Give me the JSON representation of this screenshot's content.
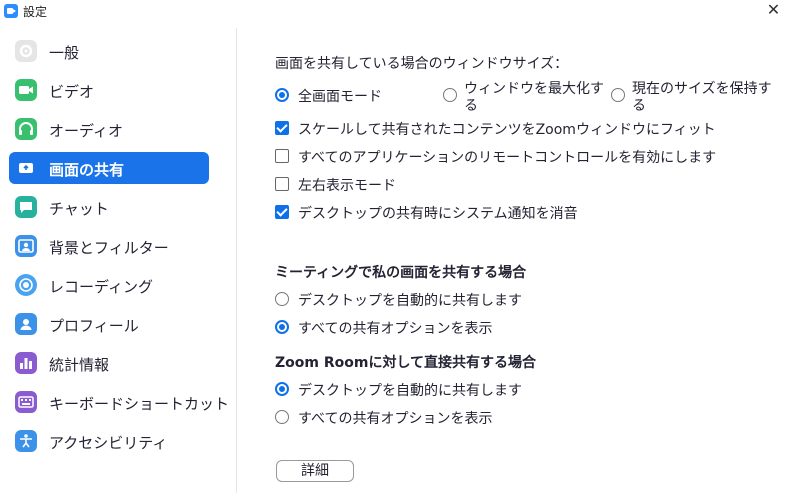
{
  "window": {
    "title": "設定",
    "close_glyph": "✕"
  },
  "sidebar": {
    "items": [
      {
        "label": "一般",
        "icon": "gear-icon",
        "color": "#e5e5e5"
      },
      {
        "label": "ビデオ",
        "icon": "video-icon",
        "color": "#38c06f"
      },
      {
        "label": "オーディオ",
        "icon": "headphones-icon",
        "color": "#38c06f"
      },
      {
        "label": "画面の共有",
        "icon": "share-screen-icon",
        "color": "#1a73e8"
      },
      {
        "label": "チャット",
        "icon": "chat-icon",
        "color": "#26b29c"
      },
      {
        "label": "背景とフィルター",
        "icon": "background-icon",
        "color": "#3c92e8"
      },
      {
        "label": "レコーディング",
        "icon": "record-icon",
        "color": "#4aa3f0"
      },
      {
        "label": "プロフィール",
        "icon": "profile-icon",
        "color": "#3c92e8"
      },
      {
        "label": "統計情報",
        "icon": "statistics-icon",
        "color": "#8a5cd0"
      },
      {
        "label": "キーボードショートカット",
        "icon": "keyboard-icon",
        "color": "#8a5cd0"
      },
      {
        "label": "アクセシビリティ",
        "icon": "accessibility-icon",
        "color": "#3c92e8"
      }
    ],
    "active_index": 3
  },
  "main": {
    "window_size_label": "画面を共有している場合のウィンドウサイズ：",
    "window_size_options": [
      {
        "line1": "全画面モード",
        "line2": "",
        "selected": true
      },
      {
        "line1": "ウィンドウを最大化す",
        "line2": "る",
        "selected": false
      },
      {
        "line1": "現在のサイズを保持す",
        "line2": "る",
        "selected": false
      }
    ],
    "checkboxes": [
      {
        "label": "スケールして共有されたコンテンツをZoomウィンドウにフィット",
        "checked": true
      },
      {
        "label": "すべてのアプリケーションのリモートコントロールを有効にします",
        "checked": false
      },
      {
        "label": "左右表示モード",
        "checked": false
      },
      {
        "label": "デスクトップの共有時にシステム通知を消音",
        "checked": true
      }
    ],
    "meeting_share_header": "ミーティングで私の画面を共有する場合",
    "meeting_share_options": [
      {
        "label": "デスクトップを自動的に共有します",
        "selected": false
      },
      {
        "label": "すべての共有オプションを表示",
        "selected": true
      }
    ],
    "zoom_room_header": "Zoom Roomに対して直接共有する場合",
    "zoom_room_options": [
      {
        "label": "デスクトップを自動的に共有します",
        "selected": true
      },
      {
        "label": "すべての共有オプションを表示",
        "selected": false
      }
    ],
    "advanced_button": "詳細"
  }
}
